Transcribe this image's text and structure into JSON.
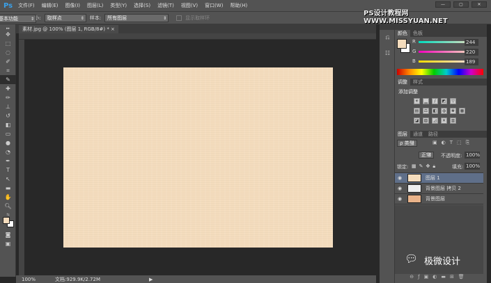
{
  "app": {
    "logo": "Ps"
  },
  "menu": [
    "文件(F)",
    "编辑(E)",
    "图像(I)",
    "图层(L)",
    "类型(Y)",
    "选择(S)",
    "滤镜(T)",
    "视图(V)",
    "窗口(W)",
    "帮助(H)"
  ],
  "window_controls": [
    "—",
    "▢",
    "✕"
  ],
  "options": {
    "sample_size_label": "取样大小:",
    "sample_size_value": "取样点",
    "sample_label": "样本:",
    "sample_value": "所有图层",
    "show_ring": "显示取样环"
  },
  "watermark": "PS设计教程网  WWW.MISSYUAN.NET",
  "workspace": "基本功能",
  "document_tab": "素材.jpg @ 100% (图层 1, RGB/8#) *  ×",
  "status": {
    "zoom": "100%",
    "doc": "文档:929.9K/2.72M"
  },
  "color_panel": {
    "tabs": [
      "颜色",
      "色板"
    ],
    "r": "244",
    "g": "220",
    "b": "189",
    "foreground": "#f4dcbd"
  },
  "adjust_panel": {
    "tabs": [
      "调整",
      "样式"
    ],
    "title": "添加调整"
  },
  "layers_panel": {
    "tabs": [
      "图层",
      "通道",
      "路径"
    ],
    "filter": "ρ 类型",
    "blend": "正常",
    "opacity_label": "不透明度:",
    "opacity": "100%",
    "lock_label": "锁定:",
    "fill_label": "填充:",
    "fill": "100%",
    "layers": [
      {
        "name": "图层 1",
        "selected": true
      },
      {
        "name": "背景图层 拷贝 2",
        "selected": false
      },
      {
        "name": "背景图层",
        "selected": false
      }
    ]
  },
  "wechat_watermark": "极微设计"
}
